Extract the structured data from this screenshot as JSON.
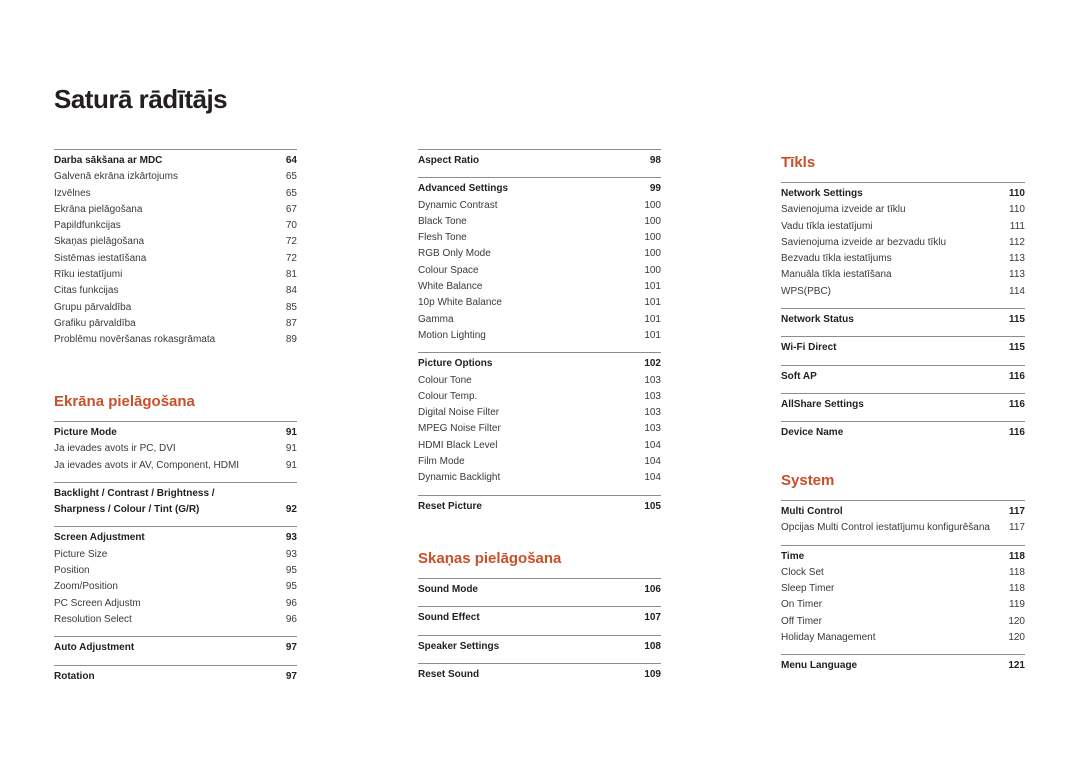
{
  "title": "Saturā rādītājs",
  "accent_color": "#c8502a",
  "columns": [
    {
      "sections": [
        {
          "heading": "",
          "groups": [
            {
              "title": "Darba sākšana ar MDC",
              "page": "64",
              "items": [
                {
                  "label": "Galvenā ekrāna izkārtojums",
                  "page": "65"
                },
                {
                  "label": "Izvēlnes",
                  "page": "65"
                },
                {
                  "label": "Ekrāna pielāgošana",
                  "page": "67"
                },
                {
                  "label": "Papildfunkcijas",
                  "page": "70"
                },
                {
                  "label": "Skaņas pielāgošana",
                  "page": "72"
                },
                {
                  "label": "Sistēmas iestatīšana",
                  "page": "72"
                },
                {
                  "label": "Rīku iestatījumi",
                  "page": "81"
                },
                {
                  "label": "Citas funkcijas",
                  "page": "84"
                },
                {
                  "label": "Grupu pārvaldība",
                  "page": "85"
                },
                {
                  "label": "Grafiku pārvaldība",
                  "page": "87"
                },
                {
                  "label": "Problēmu novēršanas rokasgrāmata",
                  "page": "89"
                }
              ]
            }
          ]
        },
        {
          "heading": "Ekrāna pielāgošana",
          "groups": [
            {
              "title": "Picture Mode",
              "page": "91",
              "items": [
                {
                  "label": "Ja ievades avots ir PC, DVI",
                  "page": "91"
                },
                {
                  "label": "Ja ievades avots ir AV, Component, HDMI",
                  "page": "91"
                }
              ]
            },
            {
              "title": "Backlight / Contrast / Brightness / Sharpness / Colour / Tint (G/R)",
              "page": "92",
              "items": []
            },
            {
              "title": "Screen Adjustment",
              "page": "93",
              "items": [
                {
                  "label": "Picture Size",
                  "page": "93"
                },
                {
                  "label": "Position",
                  "page": "95"
                },
                {
                  "label": "Zoom/Position",
                  "page": "95"
                },
                {
                  "label": "PC Screen Adjustm",
                  "page": "96"
                },
                {
                  "label": "Resolution Select",
                  "page": "96"
                }
              ]
            },
            {
              "title": "Auto Adjustment",
              "page": "97",
              "items": []
            },
            {
              "title": "Rotation",
              "page": "97",
              "items": []
            }
          ]
        }
      ]
    },
    {
      "sections": [
        {
          "heading": "",
          "groups": [
            {
              "title": "Aspect Ratio",
              "page": "98",
              "items": []
            },
            {
              "title": "Advanced Settings",
              "page": "99",
              "items": [
                {
                  "label": "Dynamic Contrast",
                  "page": "100"
                },
                {
                  "label": "Black Tone",
                  "page": "100"
                },
                {
                  "label": "Flesh Tone",
                  "page": "100"
                },
                {
                  "label": "RGB Only Mode",
                  "page": "100"
                },
                {
                  "label": "Colour Space",
                  "page": "100"
                },
                {
                  "label": "White Balance",
                  "page": "101"
                },
                {
                  "label": "10p White Balance",
                  "page": "101"
                },
                {
                  "label": "Gamma",
                  "page": "101"
                },
                {
                  "label": "Motion Lighting",
                  "page": "101"
                }
              ]
            },
            {
              "title": "Picture Options",
              "page": "102",
              "items": [
                {
                  "label": "Colour Tone",
                  "page": "103"
                },
                {
                  "label": "Colour Temp.",
                  "page": "103"
                },
                {
                  "label": "Digital Noise Filter",
                  "page": "103"
                },
                {
                  "label": "MPEG Noise Filter",
                  "page": "103"
                },
                {
                  "label": "HDMI Black Level",
                  "page": "104"
                },
                {
                  "label": "Film Mode",
                  "page": "104"
                },
                {
                  "label": "Dynamic Backlight",
                  "page": "104"
                }
              ]
            },
            {
              "title": "Reset Picture",
              "page": "105",
              "items": []
            }
          ]
        },
        {
          "heading": "Skaņas pielāgošana",
          "groups": [
            {
              "title": "Sound Mode",
              "page": "106",
              "items": []
            },
            {
              "title": "Sound Effect",
              "page": "107",
              "items": []
            },
            {
              "title": "Speaker Settings",
              "page": "108",
              "items": []
            },
            {
              "title": "Reset Sound",
              "page": "109",
              "items": []
            }
          ]
        }
      ]
    },
    {
      "sections": [
        {
          "heading": "Tīkls",
          "groups": [
            {
              "title": "Network Settings",
              "page": "110",
              "items": [
                {
                  "label": "Savienojuma izveide ar tīklu",
                  "page": "110"
                },
                {
                  "label": "Vadu tīkla iestatījumi",
                  "page": "111"
                },
                {
                  "label": "Savienojuma izveide ar bezvadu tīklu",
                  "page": "112"
                },
                {
                  "label": "Bezvadu tīkla iestatījums",
                  "page": "113"
                },
                {
                  "label": "Manuāla tīkla iestatīšana",
                  "page": "113"
                },
                {
                  "label": "WPS(PBC)",
                  "page": "114"
                }
              ]
            },
            {
              "title": "Network Status",
              "page": "115",
              "items": []
            },
            {
              "title": "Wi-Fi Direct",
              "page": "115",
              "items": []
            },
            {
              "title": "Soft AP",
              "page": "116",
              "items": []
            },
            {
              "title": "AllShare Settings",
              "page": "116",
              "items": []
            },
            {
              "title": "Device Name",
              "page": "116",
              "items": []
            }
          ]
        },
        {
          "heading": "System",
          "groups": [
            {
              "title": "Multi Control",
              "page": "117",
              "items": [
                {
                  "label": "Opcijas Multi Control iestatījumu konfigurēšana",
                  "page": "117"
                }
              ]
            },
            {
              "title": "Time",
              "page": "118",
              "items": [
                {
                  "label": "Clock Set",
                  "page": "118"
                },
                {
                  "label": "Sleep Timer",
                  "page": "118"
                },
                {
                  "label": "On Timer",
                  "page": "119"
                },
                {
                  "label": "Off Timer",
                  "page": "120"
                },
                {
                  "label": "Holiday Management",
                  "page": "120"
                }
              ]
            },
            {
              "title": "Menu Language",
              "page": "121",
              "items": []
            }
          ]
        }
      ]
    }
  ]
}
